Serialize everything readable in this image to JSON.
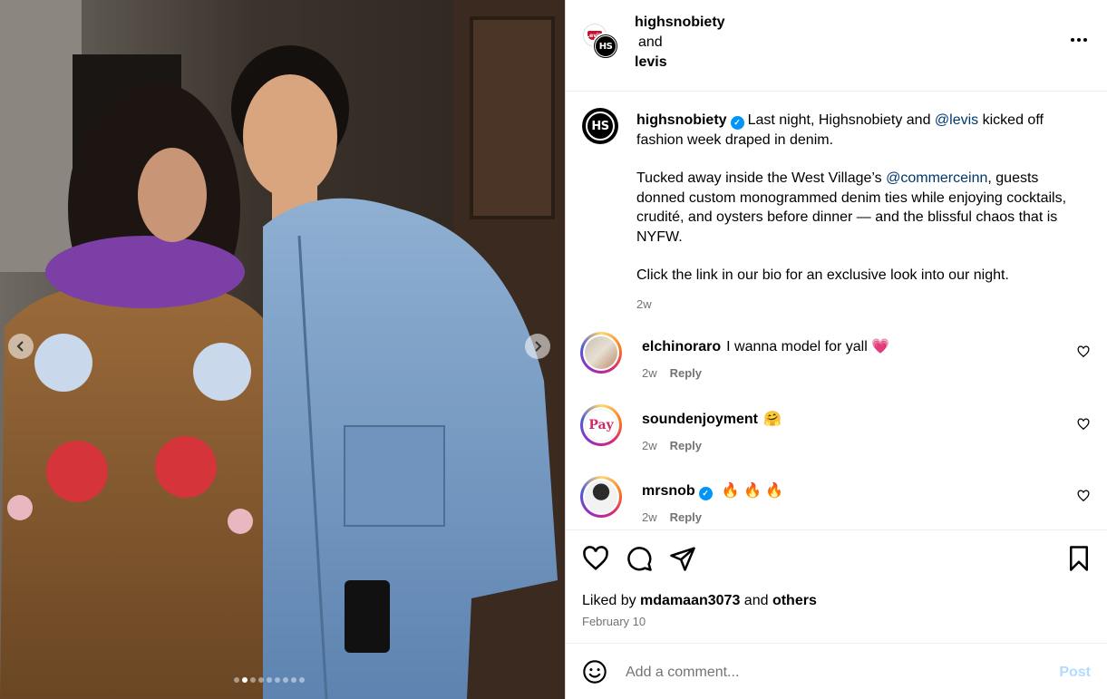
{
  "post": {
    "authors": [
      "highsnobiety",
      "and",
      "levis"
    ],
    "avatar_main_text": "HS",
    "avatar_collab_text": "Levi's"
  },
  "caption": {
    "user": "highsnobiety",
    "line1_pre": "Last night, Highsnobiety and ",
    "mention1": "@levis",
    "line1_post": " kicked off fashion week draped in denim.",
    "para2_pre": "Tucked away inside the West Village’s ",
    "mention2": "@commerceinn",
    "para2_post": ", guests donned custom monogrammed denim ties while enjoying cocktails, crudité, and oysters before dinner — and the blissful chaos that is NYFW.",
    "para3": "Click the link in our bio for an exclusive look into our night.",
    "time": "2w"
  },
  "comments": [
    {
      "user": "elchinoraro",
      "text": "I wanna model for yall 💗",
      "time": "2w",
      "reply": "Reply",
      "verified": false
    },
    {
      "user": "soundenjoyment",
      "text": "🤗",
      "time": "2w",
      "reply": "Reply",
      "verified": false,
      "avatar_text": "Pay"
    },
    {
      "user": "mrsnob",
      "text": "🔥 🔥 🔥",
      "time": "2w",
      "reply": "Reply",
      "verified": true
    }
  ],
  "likes": {
    "prefix": "Liked by ",
    "user": "mdamaan3073",
    "middle": " and ",
    "others": "others"
  },
  "date": "February 10",
  "add_comment": {
    "placeholder": "Add a comment...",
    "post_label": "Post"
  },
  "carousel": {
    "total": 9,
    "active": 1
  },
  "colors": {
    "accent": "#0095f6",
    "link": "#00376b",
    "muted": "#737373",
    "post_disabled": "#b3dbff"
  }
}
